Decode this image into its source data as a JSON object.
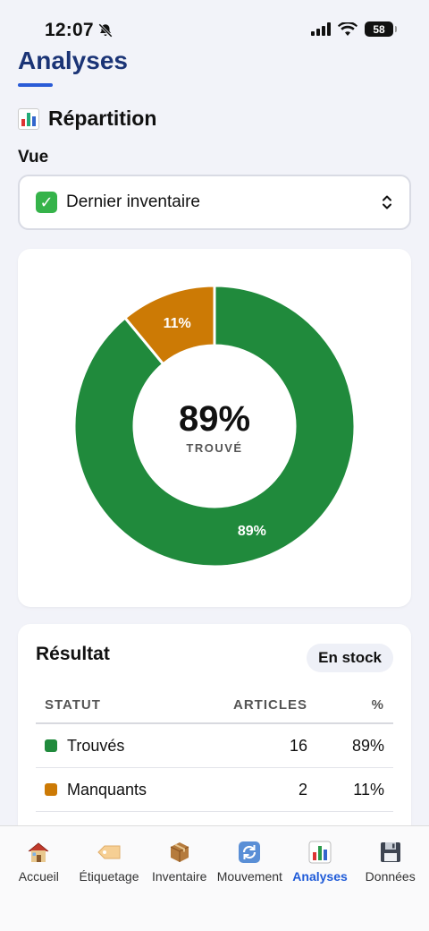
{
  "status_bar": {
    "time": "12:07",
    "battery": "58"
  },
  "header": {
    "title": "Analyses"
  },
  "section": {
    "title": "Répartition"
  },
  "view": {
    "label": "Vue",
    "selected": "Dernier inventaire"
  },
  "chart_data": {
    "type": "pie",
    "style": "donut",
    "categories": [
      "Trouvés",
      "Manquants"
    ],
    "values": [
      89,
      11
    ],
    "slice_labels": [
      "89%",
      "11%"
    ],
    "colors": [
      "#208a3c",
      "#cc7a05"
    ],
    "center_value": "89%",
    "center_label": "TROUVÉ"
  },
  "result": {
    "title": "Résultat",
    "filter_pill": "En stock",
    "columns": [
      "STATUT",
      "ARTICLES",
      "%"
    ],
    "rows": [
      {
        "status": "Trouvés",
        "count": "16",
        "percent": "89%",
        "color": "#208a3c"
      },
      {
        "status": "Manquants",
        "count": "2",
        "percent": "11%",
        "color": "#cc7a05"
      }
    ]
  },
  "tabs": [
    {
      "label": "Accueil",
      "icon": "house-icon"
    },
    {
      "label": "Étiquetage",
      "icon": "label-tag-icon"
    },
    {
      "label": "Inventaire",
      "icon": "package-icon"
    },
    {
      "label": "Mouvement",
      "icon": "refresh-icon"
    },
    {
      "label": "Analyses",
      "icon": "bar-chart-icon",
      "active": true
    },
    {
      "label": "Données",
      "icon": "floppy-disk-icon"
    }
  ]
}
